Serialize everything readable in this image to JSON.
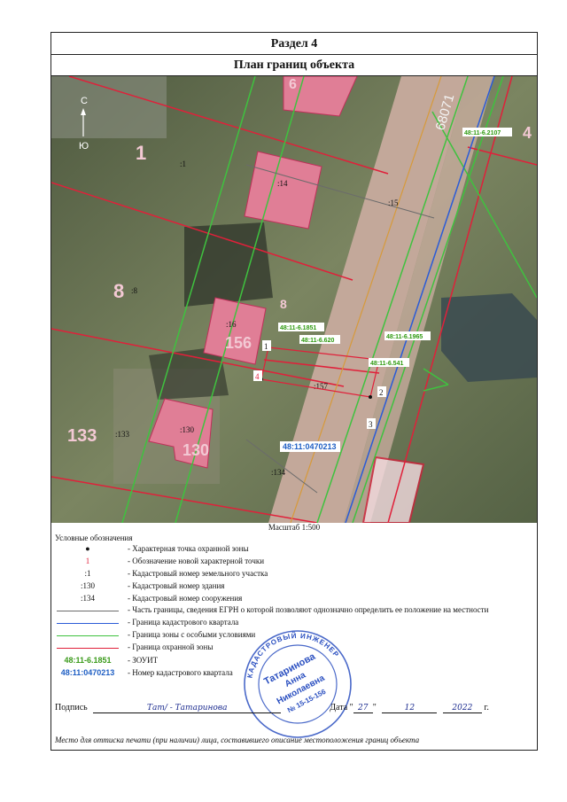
{
  "section": "Раздел 4",
  "title": "План границ объекта",
  "map": {
    "north": "С",
    "south": "Ю",
    "parcel_labels": {
      "l1": "1",
      "l8": "8",
      "l133": "133",
      "l130": "130",
      "l156": "156",
      "l8b": "8",
      "top": "6",
      "right": "4"
    },
    "small": {
      "c1": ":1",
      "c14": ":14",
      "c15": ":15",
      "c8": ":8",
      "c16": ":16",
      "c157": ":157",
      "c130": ":130",
      "c133": ":133",
      "c134": ":134"
    },
    "points": [
      "1",
      "2",
      "3",
      "4"
    ],
    "zouit": {
      "z2107": "48:11-6.2107",
      "z1851": "48:11-6.1851",
      "z620": "48:11-6.620",
      "z1965": "48:11-6.1965",
      "z541": "48:11-6.541"
    },
    "quarter": "48:11:0470213",
    "road": "68071"
  },
  "scale": "Масштаб 1:500",
  "legend_title": "Условные обозначения",
  "legend": {
    "i1": {
      "sym": "●",
      "text": "- Характерная точка охранной зоны"
    },
    "i2": {
      "sym": "1",
      "text": "- Обозначение новой характерной точки"
    },
    "i3": {
      "sym": ":1",
      "text": "- Кадастровый номер земельного участка"
    },
    "i4": {
      "sym": ":130",
      "text": "- Кадастровый номер здания"
    },
    "i5": {
      "sym": ":134",
      "text": "- Кадастровый номер сооружения"
    },
    "i6": {
      "text": "- Часть границы, сведения ЕГРН о которой позволяют однозначно определить ее положение на местности"
    },
    "i7": {
      "text": "- Граница кадастрового квартала"
    },
    "i8": {
      "text": "- Граница зоны с особыми условиями"
    },
    "i9": {
      "text": "- Граница охранной зоны"
    },
    "i10": {
      "sym": "48:11-6.1851",
      "text": "- ЗОУИТ"
    },
    "i11": {
      "sym": "48:11:0470213",
      "text": "- Номер кадастрового квартала"
    }
  },
  "colors": {
    "grey": "#6b6b6b",
    "blue": "#2a5bd7",
    "green": "#3fc23f",
    "red": "#e0203a",
    "zouit": "#3a9a1a",
    "quarter": "#1f5fc4"
  },
  "signature": {
    "label": "Подпись",
    "written": "Тат/ - Татаринова",
    "date_label": "Дата",
    "day": "27",
    "month": "12",
    "year": "2022",
    "year_suffix": "г."
  },
  "footnote": "Место для оттиска печати (при наличии) лица, составившего описание местоположения границ объекта",
  "stamp": {
    "ring": "КАДАСТРОВЫЙ ИНЖЕНЕР",
    "name1": "Татаринова",
    "name2": "Анна",
    "name3": "Николаевна",
    "no": "№ 15-15-156"
  }
}
